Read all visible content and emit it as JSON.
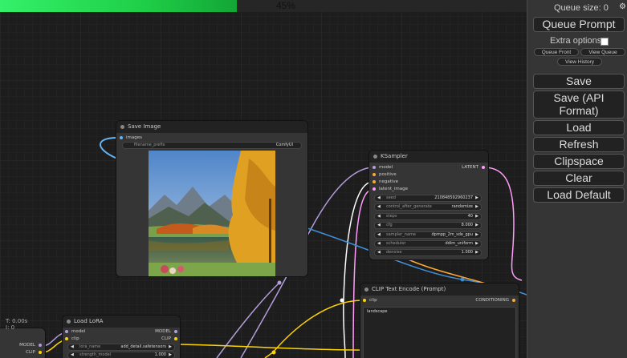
{
  "progress": {
    "percent_label": "45%",
    "value": 0.45
  },
  "status": {
    "time": "T: 0.00s",
    "iteration": "I: 0"
  },
  "panel": {
    "queue_size": "Queue size: 0",
    "queue_prompt": "Queue Prompt",
    "extra_options": "Extra options",
    "queue_front": "Queue Front",
    "view_queue": "View Queue",
    "view_history": "View History",
    "save": "Save",
    "save_api": "Save (API Format)",
    "load": "Load",
    "refresh": "Refresh",
    "clipspace": "Clipspace",
    "clear": "Clear",
    "load_default": "Load Default"
  },
  "save_image_node": {
    "title": "Save Image",
    "input_images": "images",
    "filename_prefix_label": "filename_prefix",
    "filename_prefix_value": "ComfyUI"
  },
  "ksampler_node": {
    "title": "KSampler",
    "inputs": [
      "model",
      "positive",
      "negative",
      "latent_image"
    ],
    "output": "LATENT",
    "widgets": [
      {
        "label": "seed",
        "value": "210848592960237"
      },
      {
        "label": "control_after_generate",
        "value": "randomize"
      },
      {
        "label": "steps",
        "value": "40"
      },
      {
        "label": "cfg",
        "value": "8.000"
      },
      {
        "label": "sampler_name",
        "value": "dpmpp_2m_sde_gpu"
      },
      {
        "label": "scheduler",
        "value": "ddim_uniform"
      },
      {
        "label": "denoise",
        "value": "1.000"
      }
    ]
  },
  "clip_node": {
    "title": "CLIP Text Encode (Prompt)",
    "input": "clip",
    "output": "CONDITIONING",
    "text": "landscape"
  },
  "lora_node": {
    "title": "Load LoRA",
    "inputs": [
      "model",
      "clip"
    ],
    "outputs": [
      "MODEL",
      "CLIP"
    ],
    "widgets": [
      {
        "label": "lora_name",
        "value": "add_detail.safetensors"
      },
      {
        "label": "strength_model",
        "value": "1.000"
      }
    ]
  },
  "left_node": {
    "outputs": [
      "MODEL",
      "CLIP"
    ]
  },
  "colors": {
    "model": "#b39ddb",
    "clip": "#ffd500",
    "latent": "#ff9cf9",
    "conditioning": "#ffa931",
    "image": "#64b5f6",
    "progress": "#1fcf47"
  }
}
